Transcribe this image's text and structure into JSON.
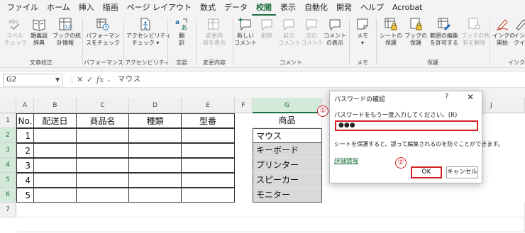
{
  "menu": {
    "tabs": [
      "ファイル",
      "ホーム",
      "挿入",
      "描画",
      "ページ レイアウト",
      "数式",
      "データ",
      "校閲",
      "表示",
      "自動化",
      "開発",
      "ヘルプ",
      "Acrobat"
    ],
    "active_index": 7
  },
  "ribbon": {
    "groups": {
      "proofing": "文章校正",
      "performance": "パフォーマンス",
      "accessibility": "アクセシビリティ",
      "language": "言語",
      "changes": "変更内容",
      "comments": "コメント",
      "notes": "メモ",
      "protect": "保護",
      "ink": "インク"
    },
    "buttons": {
      "spelling": "スペル\nチェック",
      "thesaurus": "類義語\n辞典",
      "workbook_stats": "ブックの統\n計情報",
      "check_performance": "パフォーマン\nスをチェック",
      "check_accessibility": "アクセシビリティ\nチェック ▾",
      "translate": "翻\n訳",
      "show_changes": "変更内\n容を表示",
      "new_comment": "新しい\nコメント",
      "delete": "削除",
      "prev_comment": "前の\nコメント",
      "next_comment": "次の\nコメント",
      "show_comments": "コメント\nの表示",
      "notes": "メモ\n▾",
      "protect_sheet": "シートの\n保護",
      "protect_workbook": "ブックの\n保護",
      "allow_edit_ranges": "範囲の編集\nを許可する",
      "unshare_workbook": "ブックの共\n有を解除",
      "start_inking": "インクの\n開始",
      "ink_more": "イン\nクイ"
    }
  },
  "formula_bar": {
    "name_box": "G2",
    "formula": "マウス"
  },
  "columns": [
    "A",
    "B",
    "C",
    "D",
    "E",
    "F",
    "G",
    "H",
    "I",
    "J"
  ],
  "rows": [
    "1",
    "2",
    "3",
    "4",
    "5",
    "6",
    "7"
  ],
  "table": {
    "headers": [
      "No.",
      "配送日",
      "商品名",
      "種類",
      "型番"
    ],
    "numbers": [
      "1",
      "2",
      "3",
      "4",
      "5"
    ]
  },
  "products": {
    "header": "商品",
    "items": [
      "マウス",
      "キーボード",
      "プリンター",
      "スピーカー",
      "モニター"
    ]
  },
  "dialog": {
    "title": "パスワードの確認",
    "help": "?",
    "close": "✕",
    "prompt": "パスワードをもう一度入力してください。(R)",
    "password_value": "●●●",
    "note": "シートを保護すると、誤って編集されるのを防ぐことができます。",
    "link": "詳細情報",
    "ok": "OK",
    "cancel": "キャンセル"
  },
  "annotations": {
    "step1": "①",
    "step2": "②"
  },
  "colors": {
    "accent_green": "#1e7145",
    "annotation_red": "#d42027"
  },
  "icons": [
    "spelling-icon",
    "thesaurus-icon",
    "workbook-stats-icon",
    "performance-icon",
    "accessibility-icon",
    "translate-icon",
    "show-changes-icon",
    "new-comment-icon",
    "delete-comment-icon",
    "prev-comment-icon",
    "next-comment-icon",
    "show-comments-icon",
    "notes-icon",
    "protect-sheet-icon",
    "protect-workbook-icon",
    "allow-edit-ranges-icon",
    "unshare-workbook-icon",
    "ink-icon"
  ]
}
